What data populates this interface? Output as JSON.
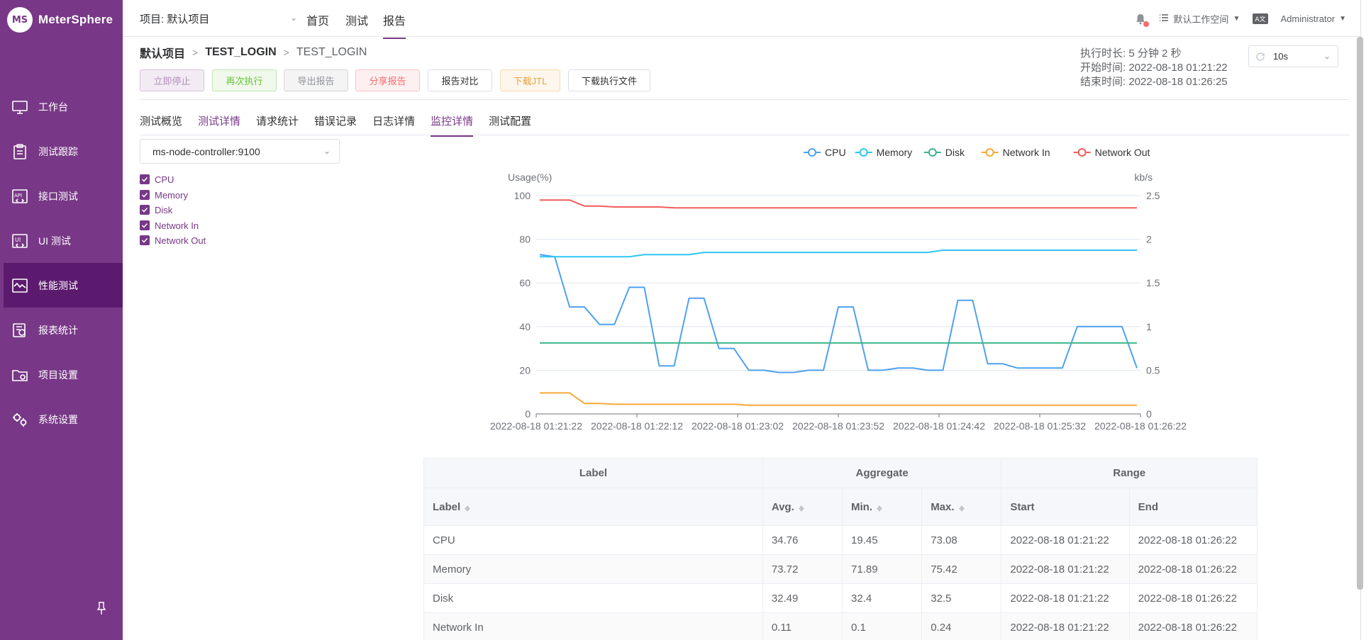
{
  "app": {
    "name": "MeterSphere",
    "logo_text": "MS"
  },
  "sidebar": {
    "items": [
      {
        "label": "工作台",
        "icon": "monitor-icon"
      },
      {
        "label": "测试跟踪",
        "icon": "clipboard-icon"
      },
      {
        "label": "接口测试",
        "icon": "api-icon"
      },
      {
        "label": "UI 测试",
        "icon": "ui-icon"
      },
      {
        "label": "性能测试",
        "icon": "performance-icon",
        "active": true
      },
      {
        "label": "报表统计",
        "icon": "report-icon"
      },
      {
        "label": "项目设置",
        "icon": "folder-settings-icon"
      },
      {
        "label": "系统设置",
        "icon": "gears-icon"
      }
    ]
  },
  "topbar": {
    "project": "项目: 默认项目",
    "nav": [
      "首页",
      "测试",
      "报告"
    ],
    "active_nav": "报告",
    "workspace": "默认工作空间",
    "user": "Administrator",
    "lang_icon": "translate-icon"
  },
  "breadcrumb": {
    "project": "默认项目",
    "test": "TEST_LOGIN",
    "report": "TEST_LOGIN"
  },
  "actions": {
    "stop": "立即停止",
    "rerun": "再次执行",
    "export": "导出报告",
    "share": "分享报告",
    "compare": "报告对比",
    "download_jtl": "下载JTL",
    "download_files": "下载执行文件"
  },
  "exec_info": {
    "duration_label": "执行时长:",
    "duration": "5 分钟 2 秒",
    "start_label": "开始时间:",
    "start": "2022-08-18 01:21:22",
    "end_label": "结束时间:",
    "end": "2022-08-18 01:26:25"
  },
  "refresh": {
    "value": "10s"
  },
  "tabs": [
    "测试概览",
    "测试详情",
    "请求统计",
    "错误记录",
    "日志详情",
    "监控详情",
    "测试配置"
  ],
  "active_tab": "监控详情",
  "node": {
    "value": "ms-node-controller:9100"
  },
  "metrics_checks": [
    "CPU",
    "Memory",
    "Disk",
    "Network In",
    "Network Out"
  ],
  "colors": {
    "brand": "#783887",
    "cpu": "#4ea1ef",
    "memory": "#2fc6f2",
    "disk": "#3fb58b",
    "network_in": "#f7a93a",
    "network_out": "#f25c5c"
  },
  "chart_data": {
    "type": "line",
    "x": [
      "2022-08-18 01:21:22",
      "2022-08-18 01:22:12",
      "2022-08-18 01:23:02",
      "2022-08-18 01:23:52",
      "2022-08-18 01:24:42",
      "2022-08-18 01:25:32",
      "2022-08-18 01:26:22"
    ],
    "left_axis": {
      "label": "Usage(%)",
      "ticks": [
        0,
        20,
        40,
        60,
        80,
        100
      ],
      "ylim": [
        0,
        100
      ]
    },
    "right_axis": {
      "label": "kb/s",
      "ticks": [
        "0",
        "0.5",
        "1",
        "1.5",
        "2",
        "2.5"
      ],
      "ylim": [
        0,
        2.5
      ]
    },
    "grid": true,
    "legend": "top",
    "series": [
      {
        "name": "CPU",
        "axis": "left",
        "values": [
          73,
          72,
          49,
          49,
          41,
          41,
          58,
          58,
          22,
          22,
          53,
          53,
          30,
          30,
          20,
          20,
          19,
          19,
          20,
          20,
          49,
          49,
          20,
          20,
          21,
          21,
          20,
          20,
          52,
          52,
          23,
          23,
          21,
          21,
          21,
          21,
          40,
          40,
          40,
          40,
          21
        ]
      },
      {
        "name": "Memory",
        "axis": "left",
        "values": [
          72,
          72,
          72,
          72,
          72,
          72,
          72,
          73,
          73,
          73,
          73,
          74,
          74,
          74,
          74,
          74,
          74,
          74,
          74,
          74,
          74,
          74,
          74,
          74,
          74,
          74,
          74,
          75,
          75,
          75,
          75,
          75,
          75,
          75,
          75,
          75,
          75,
          75,
          75,
          75,
          75
        ]
      },
      {
        "name": "Disk",
        "axis": "left",
        "values": [
          32.5,
          32.5,
          32.5,
          32.5,
          32.5,
          32.5,
          32.5,
          32.5,
          32.5,
          32.5,
          32.5,
          32.5,
          32.5,
          32.5,
          32.5,
          32.5,
          32.5,
          32.5,
          32.5,
          32.5,
          32.5,
          32.5,
          32.5,
          32.5,
          32.5,
          32.5,
          32.5,
          32.5,
          32.5,
          32.5,
          32.5,
          32.5,
          32.5,
          32.5,
          32.5,
          32.5,
          32.5,
          32.5,
          32.5,
          32.5,
          32.5
        ]
      },
      {
        "name": "Network In",
        "axis": "right",
        "values": [
          0.24,
          0.24,
          0.24,
          0.12,
          0.12,
          0.11,
          0.11,
          0.11,
          0.11,
          0.11,
          0.11,
          0.11,
          0.11,
          0.11,
          0.1,
          0.1,
          0.1,
          0.1,
          0.1,
          0.1,
          0.1,
          0.1,
          0.1,
          0.1,
          0.1,
          0.1,
          0.1,
          0.1,
          0.1,
          0.1,
          0.1,
          0.1,
          0.1,
          0.1,
          0.1,
          0.1,
          0.1,
          0.1,
          0.1,
          0.1,
          0.1
        ]
      },
      {
        "name": "Network Out",
        "axis": "right",
        "values": [
          2.45,
          2.45,
          2.45,
          2.38,
          2.38,
          2.37,
          2.37,
          2.37,
          2.37,
          2.36,
          2.36,
          2.36,
          2.36,
          2.36,
          2.36,
          2.36,
          2.36,
          2.36,
          2.36,
          2.36,
          2.36,
          2.36,
          2.36,
          2.36,
          2.36,
          2.36,
          2.36,
          2.36,
          2.36,
          2.36,
          2.36,
          2.36,
          2.36,
          2.36,
          2.36,
          2.36,
          2.36,
          2.36,
          2.36,
          2.36,
          2.36
        ]
      }
    ]
  },
  "table": {
    "group_headers": [
      "Label",
      "Aggregate",
      "Range"
    ],
    "columns": [
      "Label",
      "Avg.",
      "Min.",
      "Max.",
      "Start",
      "End"
    ],
    "rows": [
      [
        "CPU",
        "34.76",
        "19.45",
        "73.08",
        "2022-08-18 01:21:22",
        "2022-08-18 01:26:22"
      ],
      [
        "Memory",
        "73.72",
        "71.89",
        "75.42",
        "2022-08-18 01:21:22",
        "2022-08-18 01:26:22"
      ],
      [
        "Disk",
        "32.49",
        "32.4",
        "32.5",
        "2022-08-18 01:21:22",
        "2022-08-18 01:26:22"
      ],
      [
        "Network In",
        "0.11",
        "0.1",
        "0.24",
        "2022-08-18 01:21:22",
        "2022-08-18 01:26:22"
      ]
    ]
  }
}
